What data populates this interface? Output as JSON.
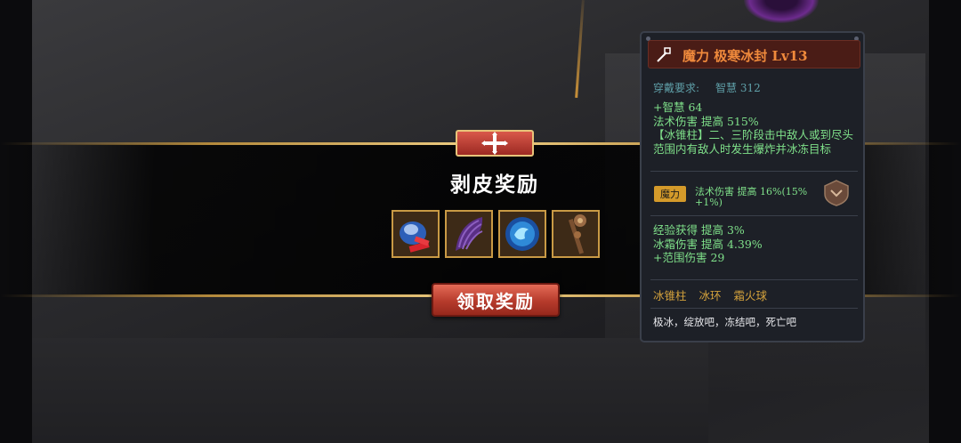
{
  "reward_panel": {
    "title": "剥皮奖励",
    "claim_label": "领取奖励",
    "items": [
      {
        "icon": "blue-pouch-icon"
      },
      {
        "icon": "purple-scales-icon"
      },
      {
        "icon": "ice-orb-icon"
      },
      {
        "icon": "scepter-staff-icon"
      }
    ]
  },
  "tooltip": {
    "weapon_icon": "staff-icon",
    "item_name": "魔力 极寒冰封 Lv13",
    "requirement_label": "穿戴要求:",
    "requirement_value": "智慧 312",
    "base_stats": [
      "+智慧 64",
      "法术伤害 提高 515%",
      "【冰锥柱】二、三阶段击中敌人或到尽头范围内有敌人时发生爆炸并冰冻目标"
    ],
    "enchant_tag": "魔力",
    "enchant_text": "法术伤害 提高 16%(15% +1%)",
    "bonus_stats": [
      "经验获得 提高 3%",
      "冰霜伤害 提高 4.39%",
      "+范围伤害 29"
    ],
    "skills": [
      "冰锥柱",
      "冰环",
      "霜火球"
    ],
    "flavor": "极冰，绽放吧，冻结吧，死亡吧"
  },
  "colors": {
    "item_name": "#f08a3c",
    "stat_green": "#7fe08a",
    "skill_gold": "#d4a23c",
    "button_red": "#b63b2c"
  }
}
